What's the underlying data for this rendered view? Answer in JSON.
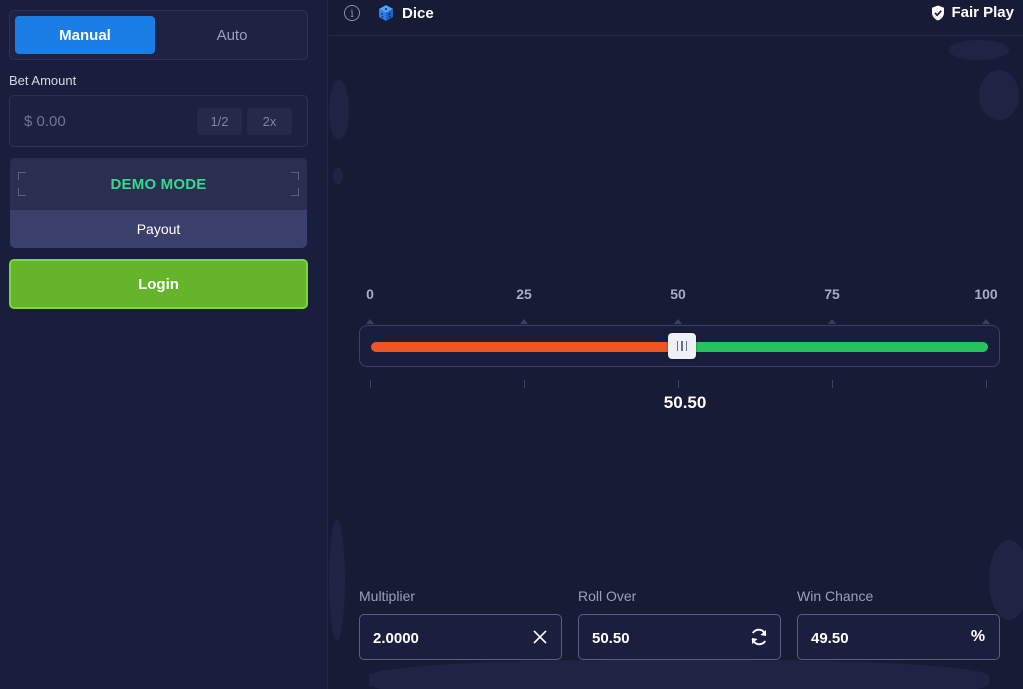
{
  "sidebar": {
    "tabs": {
      "manual": "Manual",
      "auto": "Auto"
    },
    "bet": {
      "label": "Bet Amount",
      "placeholder": "$ 0.00",
      "half_label": "1/2",
      "double_label": "2x"
    },
    "demo": {
      "title": "DEMO MODE",
      "payout_label": "Payout"
    },
    "login_label": "Login"
  },
  "header": {
    "info_glyph": "i",
    "game_title": "Dice",
    "fair_play_label": "Fair Play"
  },
  "slider": {
    "ticks": [
      "0",
      "25",
      "50",
      "75",
      "100"
    ],
    "value": 50.5,
    "value_label": "50.50",
    "min": 0,
    "max": 100,
    "colors": {
      "under": "#ee5523",
      "over": "#25c35b",
      "thumb": "#eef0f6"
    }
  },
  "stats": {
    "multiplier": {
      "label": "Multiplier",
      "value": "2.0000",
      "icon": "close-icon"
    },
    "roll_over": {
      "label": "Roll Over",
      "value": "50.50",
      "icon": "refresh-icon"
    },
    "win_chance": {
      "label": "Win Chance",
      "value": "49.50",
      "icon_text": "%"
    }
  },
  "colors": {
    "accent_blue": "#1a7ee6",
    "demo_green": "#37d98b",
    "login_green": "#65b52a",
    "background": "#171b36"
  }
}
